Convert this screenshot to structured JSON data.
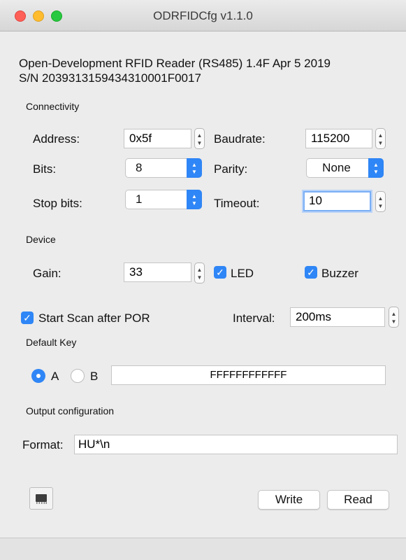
{
  "window": {
    "title": "ODRFIDCfg v1.1.0"
  },
  "info": {
    "line1": "Open-Development RFID Reader (RS485) 1.4F Apr  5 2019",
    "line2": "S/N 2039313159434310001F0017"
  },
  "connectivity": {
    "section_label": "Connectivity",
    "address_label": "Address:",
    "address_value": "0x5f",
    "baudrate_label": "Baudrate:",
    "baudrate_value": "115200",
    "bits_label": "Bits:",
    "bits_value": "8",
    "parity_label": "Parity:",
    "parity_value": "None",
    "stopbits_label": "Stop bits:",
    "stopbits_value": "1",
    "timeout_label": "Timeout:",
    "timeout_value": "10"
  },
  "device": {
    "section_label": "Device",
    "gain_label": "Gain:",
    "gain_value": "33",
    "led_label": "LED",
    "led_checked": true,
    "buzzer_label": "Buzzer",
    "buzzer_checked": true
  },
  "scan": {
    "start_label": "Start Scan after POR",
    "start_checked": true,
    "interval_label": "Interval:",
    "interval_value": "200ms"
  },
  "default_key": {
    "section_label": "Default Key",
    "option_a": "A",
    "option_b": "B",
    "selected": "A",
    "key_value": "FFFFFFFFFFFF"
  },
  "output": {
    "section_label": "Output configuration",
    "format_label": "Format:",
    "format_value": "HU*\\n"
  },
  "buttons": {
    "write": "Write",
    "read": "Read"
  },
  "icons": {
    "check": "checkmark-icon",
    "stepper": "stepper-icon",
    "chip": "chip-icon"
  },
  "colors": {
    "accent": "#2f86f6"
  }
}
